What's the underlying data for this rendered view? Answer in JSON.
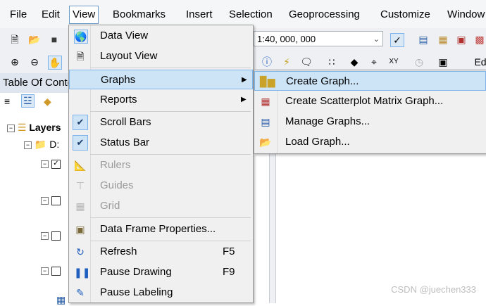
{
  "menubar": {
    "items": [
      "File",
      "Edit",
      "View",
      "Bookmarks",
      "Insert",
      "Selection",
      "Geoprocessing",
      "Customize",
      "Window"
    ],
    "active": "View"
  },
  "toolbar": {
    "scale_value": "1:40, 000, 000",
    "right_label": "Ed"
  },
  "toc": {
    "title": "Table Of Contents",
    "layers_label": "Layers",
    "folder_label": "D:"
  },
  "view_menu": {
    "items": [
      {
        "label": "Data View",
        "icon": "data-view-icon",
        "enabled": true
      },
      {
        "label": "Layout View",
        "icon": "layout-view-icon",
        "enabled": true
      },
      {
        "label": "Graphs",
        "icon": "",
        "enabled": true,
        "submenu": true,
        "highlighted": true
      },
      {
        "label": "Reports",
        "icon": "",
        "enabled": true,
        "submenu": true
      },
      {
        "label": "Scroll Bars",
        "checked": true,
        "enabled": true
      },
      {
        "label": "Status Bar",
        "checked": true,
        "enabled": true
      },
      {
        "label": "Rulers",
        "icon": "rulers-icon",
        "enabled": false
      },
      {
        "label": "Guides",
        "icon": "guides-icon",
        "enabled": false
      },
      {
        "label": "Grid",
        "icon": "grid-icon",
        "enabled": false
      },
      {
        "label": "Data Frame Properties...",
        "icon": "data-frame-properties-icon",
        "enabled": true
      },
      {
        "label": "Refresh",
        "icon": "refresh-icon",
        "enabled": true,
        "shortcut": "F5"
      },
      {
        "label": "Pause Drawing",
        "icon": "pause-icon",
        "enabled": true,
        "shortcut": "F9"
      },
      {
        "label": "Pause Labeling",
        "icon": "pause-labeling-icon",
        "enabled": true
      }
    ]
  },
  "graphs_submenu": {
    "items": [
      {
        "label": "Create Graph...",
        "icon": "bar-chart-icon",
        "highlighted": true
      },
      {
        "label": "Create Scatterplot Matrix Graph...",
        "icon": "scatterplot-matrix-icon"
      },
      {
        "label": "Manage Graphs...",
        "icon": "manage-graphs-icon"
      },
      {
        "label": "Load Graph...",
        "icon": "folder-open-icon"
      }
    ]
  },
  "watermark": "CSDN @juechen333",
  "colors": {
    "highlight_bg": "#cde4f7",
    "highlight_border": "#7eb4ea",
    "menu_bg": "#f0f0f0",
    "disabled_text": "#9a9a9a"
  }
}
